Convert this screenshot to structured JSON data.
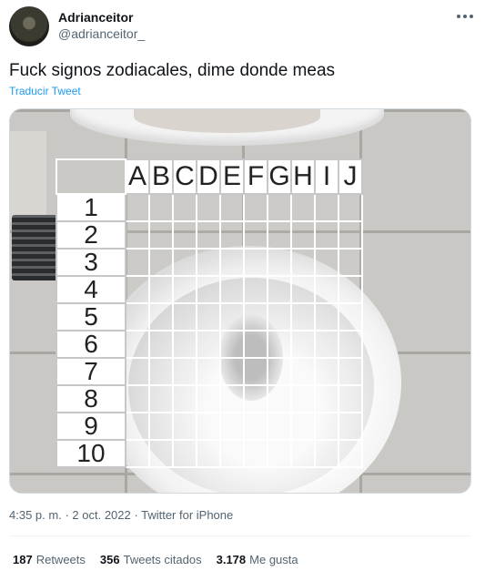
{
  "author": {
    "display_name": "Adrianceitor",
    "handle": "@adrianceitor_"
  },
  "more_icon": "more-horizontal-icon",
  "tweet": {
    "text": "Fuck signos zodiacales, dime donde meas",
    "translate_label": "Traducir Tweet"
  },
  "media": {
    "column_labels": [
      "A",
      "B",
      "C",
      "D",
      "E",
      "F",
      "G",
      "H",
      "I",
      "J"
    ],
    "row_labels": [
      "1",
      "2",
      "3",
      "4",
      "5",
      "6",
      "7",
      "8",
      "9",
      "10"
    ]
  },
  "meta": {
    "time": "4:35 p. m.",
    "separator": "·",
    "date": "2 oct. 2022",
    "source": "Twitter for iPhone"
  },
  "stats": {
    "retweets_count": "187",
    "retweets_label": "Retweets",
    "quotes_count": "356",
    "quotes_label": "Tweets citados",
    "likes_count": "3.178",
    "likes_label": "Me gusta"
  },
  "colors": {
    "link": "#1d9bf0",
    "secondary_text": "#536471",
    "primary_text": "#0f1419"
  }
}
